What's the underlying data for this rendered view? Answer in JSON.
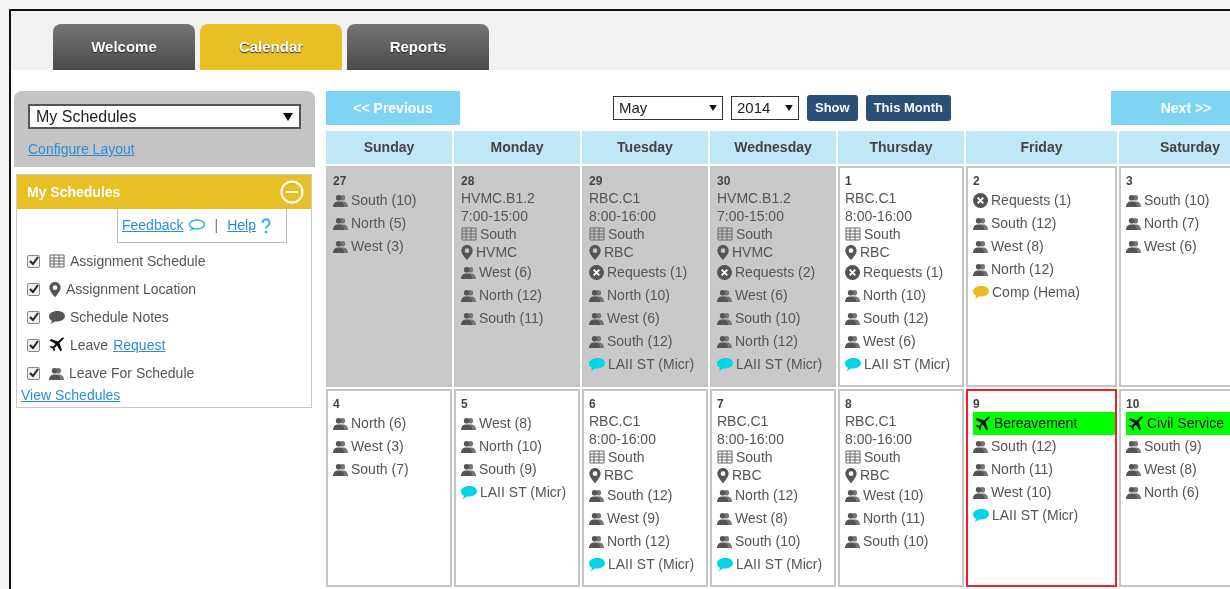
{
  "tabs": [
    {
      "label": "Welcome",
      "selected": false
    },
    {
      "label": "Calendar",
      "selected": true
    },
    {
      "label": "Reports",
      "selected": false
    }
  ],
  "sidebar": {
    "view_select": "My Schedules",
    "configure_link": "Configure Layout",
    "panel_title": "My Schedules",
    "feedback_link": "Feedback",
    "separator": "|",
    "help_link": "Help",
    "options": [
      {
        "kind": "schedule",
        "label": "Assignment Schedule",
        "checked": true
      },
      {
        "kind": "location",
        "label": "Assignment Location",
        "checked": true
      },
      {
        "kind": "note",
        "label": "Schedule Notes",
        "checked": true
      },
      {
        "kind": "leave",
        "label": "Leave",
        "link": "Request",
        "checked": true
      },
      {
        "kind": "group",
        "label": "Leave For Schedule",
        "checked": true
      }
    ],
    "view_link": "View Schedules"
  },
  "nav": {
    "previous": "<< Previous",
    "month": "May",
    "year": "2014",
    "show": "Show",
    "this_month": "This Month",
    "next": "Next >>"
  },
  "weekdays": [
    "Sunday",
    "Monday",
    "Tuesday",
    "Wednesday",
    "Thursday",
    "Friday",
    "Saturday"
  ],
  "weeks": [
    {
      "days": [
        {
          "date": "27",
          "muted": true,
          "today": false,
          "entries": [
            {
              "kind": "group",
              "text": "South (10)"
            },
            {
              "kind": "group",
              "text": "North (5)"
            },
            {
              "kind": "group",
              "text": "West (3)"
            }
          ]
        },
        {
          "date": "28",
          "muted": true,
          "today": false,
          "entries": [
            {
              "kind": "site",
              "text": "HVMC.B1.2"
            },
            {
              "kind": "time",
              "text": "7:00-15:00"
            },
            {
              "kind": "schedule",
              "text": "South"
            },
            {
              "kind": "location",
              "text": "HVMC"
            },
            {
              "kind": "group",
              "text": "West (6)"
            },
            {
              "kind": "group",
              "text": "North (12)"
            },
            {
              "kind": "group",
              "text": "South (11)"
            }
          ]
        },
        {
          "date": "29",
          "muted": true,
          "today": false,
          "entries": [
            {
              "kind": "site",
              "text": "RBC.C1"
            },
            {
              "kind": "time",
              "text": "8:00-16:00"
            },
            {
              "kind": "schedule",
              "text": "South"
            },
            {
              "kind": "location",
              "text": "RBC"
            },
            {
              "kind": "request",
              "text": "Requests (1)"
            },
            {
              "kind": "group",
              "text": "North (10)"
            },
            {
              "kind": "group",
              "text": "West (6)"
            },
            {
              "kind": "group",
              "text": "South (12)"
            },
            {
              "kind": "note",
              "text": "LAII ST (Micr)",
              "color": "#00d4e6"
            }
          ]
        },
        {
          "date": "30",
          "muted": true,
          "today": false,
          "entries": [
            {
              "kind": "site",
              "text": "HVMC.B1.2"
            },
            {
              "kind": "time",
              "text": "7:00-15:00"
            },
            {
              "kind": "schedule",
              "text": "South"
            },
            {
              "kind": "location",
              "text": "HVMC"
            },
            {
              "kind": "request",
              "text": "Requests (2)"
            },
            {
              "kind": "group",
              "text": "West (6)"
            },
            {
              "kind": "group",
              "text": "South (10)"
            },
            {
              "kind": "group",
              "text": "North (12)"
            },
            {
              "kind": "note",
              "text": "LAII ST (Micr)",
              "color": "#00d4e6"
            }
          ]
        },
        {
          "date": "1",
          "muted": false,
          "today": false,
          "entries": [
            {
              "kind": "site",
              "text": "RBC.C1"
            },
            {
              "kind": "time",
              "text": "8:00-16:00"
            },
            {
              "kind": "schedule",
              "text": "South"
            },
            {
              "kind": "location",
              "text": "RBC"
            },
            {
              "kind": "request",
              "text": "Requests (1)"
            },
            {
              "kind": "group",
              "text": "North (10)"
            },
            {
              "kind": "group",
              "text": "South (12)"
            },
            {
              "kind": "group",
              "text": "West (6)"
            },
            {
              "kind": "note",
              "text": "LAII ST (Micr)",
              "color": "#00d4e6"
            }
          ]
        },
        {
          "date": "2",
          "muted": false,
          "today": false,
          "entries": [
            {
              "kind": "request",
              "text": "Requests (1)"
            },
            {
              "kind": "group",
              "text": "South (12)"
            },
            {
              "kind": "group",
              "text": "West (8)"
            },
            {
              "kind": "group",
              "text": "North (12)"
            },
            {
              "kind": "note",
              "text": "Comp (Hema)",
              "color": "#e8bc20"
            }
          ]
        },
        {
          "date": "3",
          "muted": false,
          "today": false,
          "entries": [
            {
              "kind": "group",
              "text": "South (10)"
            },
            {
              "kind": "group",
              "text": "North (7)"
            },
            {
              "kind": "group",
              "text": "West (6)"
            }
          ]
        }
      ]
    },
    {
      "days": [
        {
          "date": "4",
          "muted": false,
          "today": false,
          "entries": [
            {
              "kind": "group",
              "text": "North (6)"
            },
            {
              "kind": "group",
              "text": "West (3)"
            },
            {
              "kind": "group",
              "text": "South (7)"
            }
          ]
        },
        {
          "date": "5",
          "muted": false,
          "today": false,
          "entries": [
            {
              "kind": "group",
              "text": "West (8)"
            },
            {
              "kind": "group",
              "text": "North (10)"
            },
            {
              "kind": "group",
              "text": "South (9)"
            },
            {
              "kind": "note",
              "text": "LAII ST (Micr)",
              "color": "#00d4e6"
            }
          ]
        },
        {
          "date": "6",
          "muted": false,
          "today": false,
          "entries": [
            {
              "kind": "site",
              "text": "RBC.C1"
            },
            {
              "kind": "time",
              "text": "8:00-16:00"
            },
            {
              "kind": "schedule",
              "text": "South"
            },
            {
              "kind": "location",
              "text": "RBC"
            },
            {
              "kind": "group",
              "text": "South (12)"
            },
            {
              "kind": "group",
              "text": "West (9)"
            },
            {
              "kind": "group",
              "text": "North (12)"
            },
            {
              "kind": "note",
              "text": "LAII ST (Micr)",
              "color": "#00d4e6"
            }
          ]
        },
        {
          "date": "7",
          "muted": false,
          "today": false,
          "entries": [
            {
              "kind": "site",
              "text": "RBC.C1"
            },
            {
              "kind": "time",
              "text": "8:00-16:00"
            },
            {
              "kind": "schedule",
              "text": "South"
            },
            {
              "kind": "location",
              "text": "RBC"
            },
            {
              "kind": "group",
              "text": "North (12)"
            },
            {
              "kind": "group",
              "text": "West (8)"
            },
            {
              "kind": "group",
              "text": "South (10)"
            },
            {
              "kind": "note",
              "text": "LAII ST (Micr)",
              "color": "#00d4e6"
            }
          ]
        },
        {
          "date": "8",
          "muted": false,
          "today": false,
          "entries": [
            {
              "kind": "site",
              "text": "RBC.C1"
            },
            {
              "kind": "time",
              "text": "8:00-16:00"
            },
            {
              "kind": "schedule",
              "text": "South"
            },
            {
              "kind": "location",
              "text": "RBC"
            },
            {
              "kind": "group",
              "text": "West (10)"
            },
            {
              "kind": "group",
              "text": "North (11)"
            },
            {
              "kind": "group",
              "text": "South (10)"
            }
          ]
        },
        {
          "date": "9",
          "muted": false,
          "today": true,
          "entries": [
            {
              "kind": "leave",
              "text": "Bereavement",
              "color": "#00ff00"
            },
            {
              "kind": "group",
              "text": "South (12)"
            },
            {
              "kind": "group",
              "text": "North (11)"
            },
            {
              "kind": "group",
              "text": "West (10)"
            },
            {
              "kind": "note",
              "text": "LAII ST (Micr)",
              "color": "#00d4e6"
            }
          ]
        },
        {
          "date": "10",
          "muted": false,
          "today": false,
          "entries": [
            {
              "kind": "leave",
              "text": "Civil Service",
              "color": "#00ff00"
            },
            {
              "kind": "group",
              "text": "South (9)"
            },
            {
              "kind": "group",
              "text": "West (8)"
            },
            {
              "kind": "group",
              "text": "North (6)"
            }
          ]
        }
      ]
    }
  ]
}
